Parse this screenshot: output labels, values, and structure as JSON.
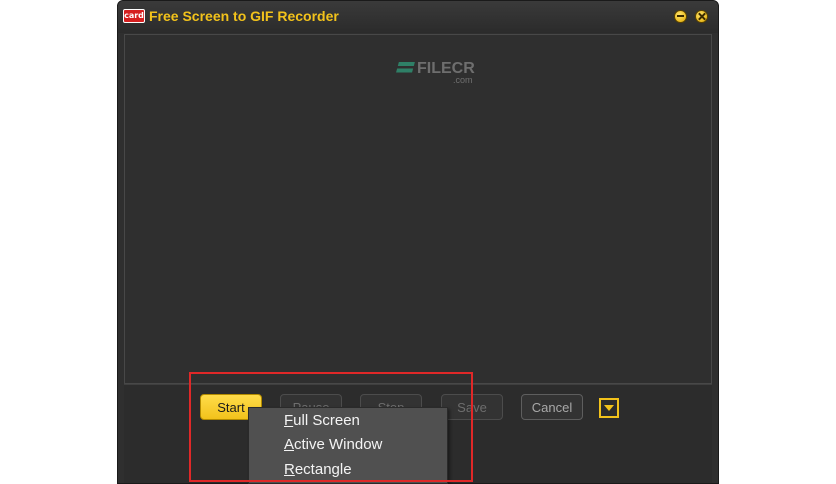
{
  "window": {
    "title": "Free Screen to GIF Recorder",
    "icon_label": "card"
  },
  "watermark": {
    "brand": "FILECR",
    "suffix": ".com"
  },
  "controls": {
    "start": "Start",
    "pause": "Pause",
    "stop": "Stop",
    "save": "Save",
    "cancel": "Cancel"
  },
  "menu": {
    "items": [
      {
        "mnemonic": "F",
        "rest": "ull Screen"
      },
      {
        "mnemonic": "A",
        "rest": "ctive Window"
      },
      {
        "mnemonic": "R",
        "rest": "ectangle"
      }
    ]
  },
  "colors": {
    "accent": "#f2c21b",
    "background": "#2f2f2f",
    "highlight": "#e02828",
    "menu_bg": "#505050"
  },
  "icons": {
    "app": "app-icon",
    "minimize": "minimize-icon",
    "close": "close-icon",
    "dropdown": "dropdown-arrow-icon"
  }
}
